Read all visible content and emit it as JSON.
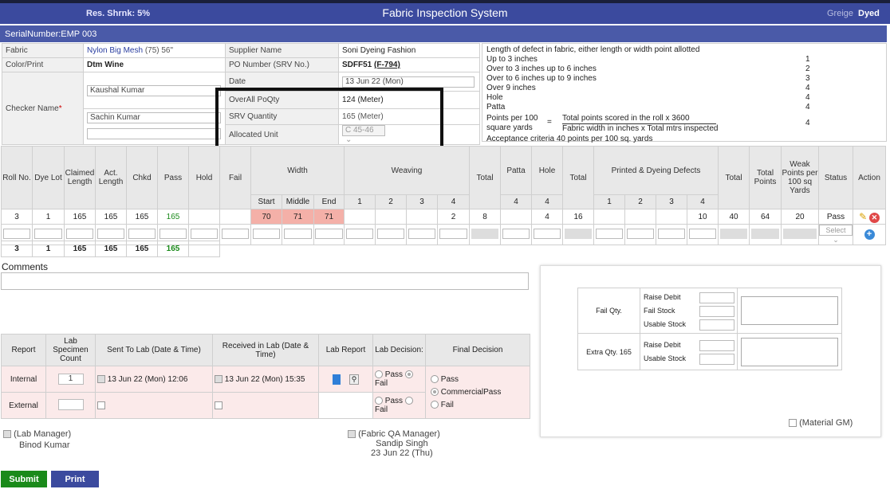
{
  "header": {
    "res_shrink": "Res. Shrnk: 5%",
    "title": "Fabric Inspection System",
    "greige": "Greige",
    "dyed": "Dyed"
  },
  "serial": "SerialNumber:EMP 003",
  "info": {
    "fabric_label": "Fabric",
    "fabric_name": "Nylon Big Mesh",
    "fabric_extra": "(75) 56\"",
    "color_label": "Color/Print",
    "color_value": "Dtm Wine",
    "checker_label": "Checker Name",
    "checker_req": "*",
    "checker_1": "Kaushal Kumar",
    "checker_2": "Sachin Kumar",
    "checker_3": "",
    "supplier_label": "Supplier Name",
    "supplier_value": "Soni Dyeing Fashion",
    "po_label": "PO Number (SRV No.)",
    "po_value": "SDFF51",
    "po_link": "(F-794)",
    "date_label": "Date",
    "date_value": "13 Jun 22 (Mon)",
    "poqty_label": "OverAll PoQty",
    "poqty_value": "124 (Meter)",
    "srv_label": "SRV Quantity",
    "srv_value": "165 (Meter)",
    "unit_label": "Allocated Unit",
    "unit_value": "C 45-46"
  },
  "criteria": {
    "heading": "Length of defect in fabric, either length or width point allotted",
    "rows": [
      {
        "label": "Up to 3 inches",
        "pts": "1"
      },
      {
        "label": "Over to 3 inches up to 6 inches",
        "pts": "2"
      },
      {
        "label": "Over to 6 inches up to 9 inches",
        "pts": "3"
      },
      {
        "label": "Over 9 inches",
        "pts": "4"
      },
      {
        "label": "Hole",
        "pts": "4"
      },
      {
        "label": "Patta",
        "pts": "4"
      }
    ],
    "points_label_1": "Points per 100",
    "points_label_2": "square yards",
    "equals": "=",
    "numerator": "Total points scored in the roll x 3600",
    "denominator": "Fabric width in inches x Total mtrs inspected",
    "points_value": "4",
    "acceptance": "Acceptance criteria 40 points per 100 sq. yards"
  },
  "grid": {
    "headers": [
      "Roll No.",
      "Dye Lot",
      "Claimed Length",
      "Act. Length",
      "Chkd",
      "Pass",
      "Hold",
      "Fail",
      "Width",
      "Weaving",
      "Total",
      "Patta",
      "Hole",
      "Total",
      "Printed & Dyeing Defects",
      "Total",
      "Total Points",
      "Weak Points per 100 sq Yards",
      "Status",
      "Action"
    ],
    "sub": {
      "start": "Start",
      "middle": "Middle",
      "end": "End",
      "w1": "1",
      "w2": "2",
      "w3": "3",
      "w4": "4",
      "patta": "4",
      "hole": "4",
      "p1": "1",
      "p2": "2",
      "p3": "3",
      "p4": "4"
    },
    "row": {
      "roll": "3",
      "dye": "1",
      "claimed": "165",
      "actual": "165",
      "chkd": "165",
      "pass": "165",
      "start": "70",
      "middle": "71",
      "end": "71",
      "w4": "2",
      "total1": "8",
      "hole": "4",
      "total2": "16",
      "p4": "10",
      "total3": "40",
      "points": "64",
      "weak": "20",
      "status": "Pass"
    },
    "select_placeholder": "Select",
    "totals": {
      "roll": "3",
      "dye": "1",
      "claimed": "165",
      "actual": "165",
      "chkd": "165",
      "pass": "165"
    }
  },
  "comments_label": "Comments",
  "lab": {
    "headers": [
      "Report",
      "Lab Specimen Count",
      "Sent To Lab (Date & Time)",
      "Received in Lab (Date & Time)",
      "Lab Report",
      "Lab Decision:",
      "Final Decision"
    ],
    "internal_label": "Internal",
    "external_label": "External",
    "specimen_count": "1",
    "sent_internal": "13 Jun 22 (Mon) 12:06",
    "received_internal": "13 Jun 22 (Mon) 15:35",
    "pass": "Pass",
    "fail": "Fail",
    "final_pass": "Pass",
    "final_commercial": "CommercialPass",
    "final_fail": "Fail"
  },
  "signoff": {
    "lab_manager_title": "(Lab Manager)",
    "lab_manager_name": "Binod Kumar",
    "qa_manager_title": "(Fabric QA Manager)",
    "qa_manager_name": "Sandip Singh",
    "qa_manager_date": "23 Jun 22 (Thu)"
  },
  "fail_panel": {
    "fail_qty": "Fail Qty.",
    "raise_debit": "Raise Debit",
    "fail_stock": "Fail Stock",
    "usable_stock": "Usable Stock",
    "extra_qty": "Extra Qty. 165",
    "raise_debit_2": "Raise Debit",
    "usable_stock_2": "Usable Stock",
    "material_gm": "(Material GM)"
  },
  "buttons": {
    "submit": "Submit",
    "print": "Print"
  }
}
